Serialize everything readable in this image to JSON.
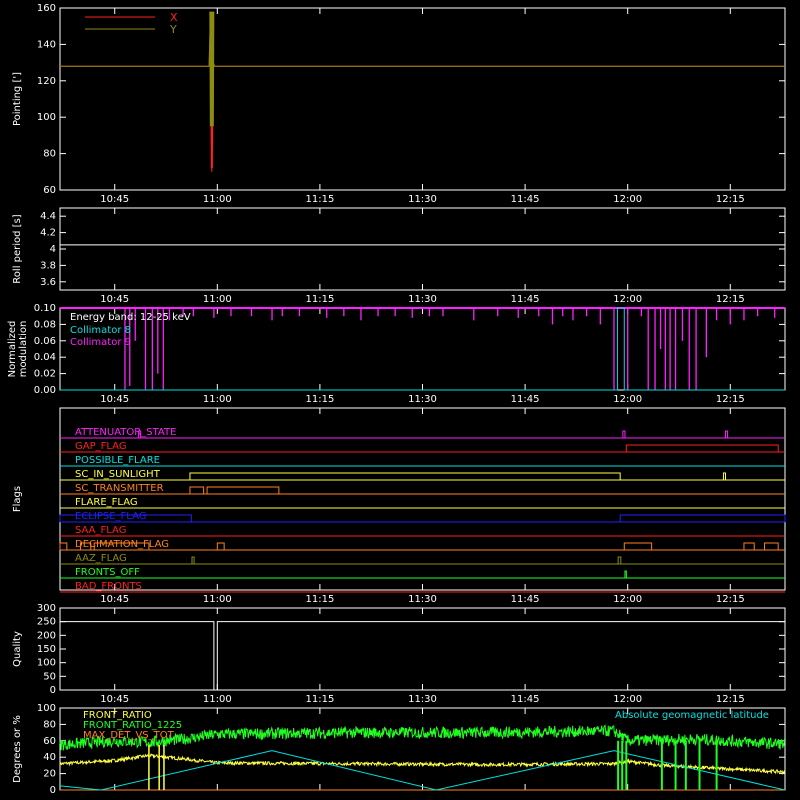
{
  "colors": {
    "background": "#000000",
    "axes": "#ffffff",
    "red": "#ff2020",
    "olive": "#8c8c10",
    "white": "#ffffff",
    "cyan": "#00e0e0",
    "magenta": "#ff20ff",
    "yellow": "#ffff40",
    "orange": "#ff8020",
    "blue": "#2020ff",
    "green": "#20ff20"
  },
  "time_axis": {
    "tick_labels": [
      "10:45",
      "11:00",
      "11:15",
      "11:30",
      "11:45",
      "12:00",
      "12:15"
    ],
    "tick_values_min": [
      645,
      660,
      675,
      690,
      705,
      720,
      735
    ],
    "range_min": [
      637,
      743
    ]
  },
  "chart_data": [
    {
      "type": "line",
      "ylabel": "Pointing [']",
      "ylim": [
        60,
        160
      ],
      "yticks": [
        60,
        80,
        100,
        120,
        140,
        160
      ],
      "legend": "top-left",
      "series": [
        {
          "name": "X",
          "color": "red",
          "x": [
            637,
            658.8,
            659,
            659.2,
            659.4,
            659.6,
            743
          ],
          "y": [
            128,
            128,
            155,
            70,
            130,
            128,
            128
          ]
        },
        {
          "name": "Y",
          "color": "olive",
          "x": [
            637,
            658.8,
            659,
            659.2,
            659.4,
            659.6,
            743
          ],
          "y": [
            128,
            128,
            158,
            95,
            130,
            128,
            128
          ]
        }
      ]
    },
    {
      "type": "line",
      "ylabel": "Roll period [s]",
      "ylim": [
        3.5,
        4.5
      ],
      "yticks": [
        3.6,
        3.8,
        4.0,
        4.2,
        4.4
      ],
      "series": [
        {
          "name": "",
          "color": "white",
          "x": [
            637,
            743
          ],
          "y": [
            4.05,
            4.05
          ]
        }
      ]
    },
    {
      "type": "line",
      "ylabel": "Normalized modulation",
      "ylim": [
        0,
        0.1
      ],
      "yticks": [
        "0.00",
        "0.02",
        "0.04",
        "0.06",
        "0.08",
        "0.10"
      ],
      "legend": "top-left",
      "annotation": "Energy band: 12-25 keV",
      "series": [
        {
          "name": "Collimator 8",
          "color": "cyan",
          "x": [
            637,
            718.5,
            718.5,
            719.5,
            719.5,
            743
          ],
          "y": [
            0,
            0,
            0.1,
            0.1,
            0,
            0
          ]
        },
        {
          "name": "Collimator 9",
          "color": "magenta",
          "baseline": 0.1,
          "dips_min": [
            646.5,
            647.2,
            648.0,
            649.5,
            650.5,
            651.3,
            652.1,
            653.0,
            655.0,
            656.5,
            659.5,
            662.0,
            665.0,
            668.0,
            669.5,
            672.0,
            676.0,
            678.5,
            681.0,
            683.5,
            686.0,
            688.5,
            691.0,
            693.0,
            697.5,
            701.0,
            704.0,
            707.0,
            709.0,
            710.5,
            712.0,
            714.0,
            716.0,
            718.0,
            720.0,
            722.0,
            723.0,
            724.0,
            724.8,
            725.5,
            726.2,
            727.0,
            728.0,
            729.0,
            730.0,
            731.5,
            733.0,
            735.0,
            737.0,
            739.0,
            741.5
          ],
          "dip_values": [
            0.0,
            0.005,
            0.06,
            0.0,
            0.0,
            0.02,
            0.0,
            0.085,
            0.09,
            0.09,
            0.088,
            0.09,
            0.09,
            0.085,
            0.09,
            0.09,
            0.088,
            0.09,
            0.085,
            0.09,
            0.09,
            0.088,
            0.09,
            0.09,
            0.085,
            0.09,
            0.088,
            0.09,
            0.08,
            0.09,
            0.085,
            0.09,
            0.08,
            0.0,
            0.0,
            0.09,
            0.0,
            0.0,
            0.05,
            0.0,
            0.0,
            0.0,
            0.06,
            0.0,
            0.0,
            0.04,
            0.085,
            0.08,
            0.085,
            0.09,
            0.088
          ]
        }
      ]
    },
    {
      "type": "table",
      "ylabel": "Flags",
      "flags": [
        {
          "name": "ATTENUATOR_STATE",
          "color": "magenta",
          "on": [
            [
              648.5,
              648.8
            ],
            [
              719.3,
              719.6
            ],
            [
              734.3,
              734.6
            ]
          ]
        },
        {
          "name": "GAP_FLAG",
          "color": "red",
          "on": [
            [
              719.8,
              742
            ]
          ]
        },
        {
          "name": "POSSIBLE_FLARE",
          "color": "cyan",
          "on": []
        },
        {
          "name": "SC_IN_SUNLIGHT",
          "color": "yellow",
          "on": [
            [
              656,
              718.9
            ],
            [
              734,
              734.3
            ]
          ]
        },
        {
          "name": "SC_TRANSMITTER",
          "color": "orange",
          "on": [
            [
              656,
              658
            ],
            [
              658.5,
              669
            ]
          ]
        },
        {
          "name": "FLARE_FLAG",
          "color": "yellow",
          "on": []
        },
        {
          "name": "ECLIPSE_FLAG",
          "color": "blue",
          "on": [
            [
              637,
              656.2
            ],
            [
              718.9,
              743
            ]
          ]
        },
        {
          "name": "SAA_FLAG",
          "color": "red",
          "on": []
        },
        {
          "name": "DECIMATION_FLAG",
          "color": "orange",
          "on": [
            [
              637,
              638
            ],
            [
              640,
              641.5
            ],
            [
              642,
              650
            ],
            [
              660,
              661
            ],
            [
              719.5,
              723.5
            ],
            [
              737,
              738.5
            ],
            [
              740,
              742
            ]
          ]
        },
        {
          "name": "AAZ_FLAG",
          "color": "olive",
          "on": [
            [
              656.3,
              656.6
            ],
            [
              718.6,
              719
            ]
          ]
        },
        {
          "name": "FRONTS_OFF",
          "color": "green",
          "on": [
            [
              719.6,
              719.8
            ]
          ]
        },
        {
          "name": "BAD_FRONTS",
          "color": "red",
          "on": []
        }
      ]
    },
    {
      "type": "line",
      "ylabel": "Quality",
      "ylim": [
        0,
        300
      ],
      "yticks": [
        0,
        50,
        100,
        150,
        200,
        250,
        300
      ],
      "series": [
        {
          "name": "",
          "color": "white",
          "x": [
            637,
            659.5,
            659.5,
            660,
            660,
            743
          ],
          "y": [
            250,
            250,
            0,
            0,
            250,
            250
          ]
        }
      ]
    },
    {
      "type": "line",
      "ylabel": "Degrees or %",
      "ylim": [
        0,
        100
      ],
      "yticks": [
        0,
        20,
        40,
        60,
        80,
        100
      ],
      "legend": "top-left",
      "series": [
        {
          "name": "FRONT_RATIO",
          "color": "yellow",
          "x": [
            637,
            645,
            650,
            655,
            660,
            700,
            718,
            720,
            725,
            743
          ],
          "y": [
            32,
            36,
            42,
            38,
            33,
            31,
            32,
            35,
            30,
            22
          ]
        },
        {
          "name": "FRONT_RATIO_1225",
          "color": "green",
          "x": [
            637,
            645,
            650,
            655,
            660,
            680,
            700,
            718,
            720,
            730,
            743
          ],
          "y": [
            55,
            60,
            58,
            62,
            68,
            70,
            70,
            72,
            60,
            62,
            56
          ]
        },
        {
          "name": "MAX_DET_VS_TOT",
          "color": "orange",
          "x": [
            637,
            743
          ],
          "y": [
            0,
            0
          ]
        },
        {
          "name": "Absolute geomagnetic latitude",
          "color": "cyan",
          "x": [
            637,
            643,
            668,
            692,
            718,
            743
          ],
          "y": [
            5,
            0,
            48,
            0,
            48,
            0
          ]
        }
      ]
    }
  ]
}
